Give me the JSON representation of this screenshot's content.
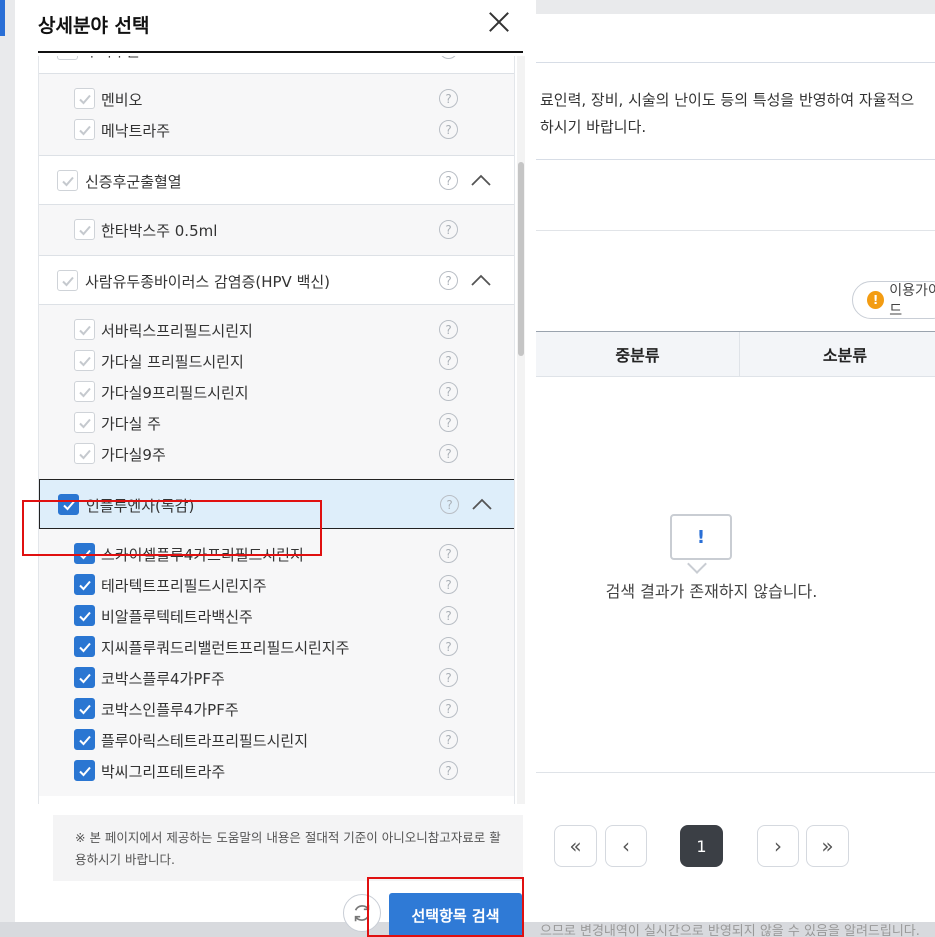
{
  "modal": {
    "title": "상세분야 선택",
    "close_icon": "close-icon",
    "help_note": "※ 본 페이지에서 제공하는 도움말의 내용은 절대적 기준이 아니오니참고자료로 활용하시기 바랍니다.",
    "reset_icon": "refresh-icon",
    "search_button": "선택항목 검색"
  },
  "groups": [
    {
      "label": "수막구균",
      "checked": false,
      "items": [
        {
          "label": "멘비오",
          "checked": false
        },
        {
          "label": "메낙트라주",
          "checked": false
        }
      ]
    },
    {
      "label": "신증후군출혈열",
      "checked": false,
      "items": [
        {
          "label": "한타박스주 0.5ml",
          "checked": false
        }
      ]
    },
    {
      "label": "사람유두종바이러스 감염증(HPV 백신)",
      "checked": false,
      "items": [
        {
          "label": "서바릭스프리필드시린지",
          "checked": false
        },
        {
          "label": "가다실 프리필드시린지",
          "checked": false
        },
        {
          "label": "가다실9프리필드시린지",
          "checked": false
        },
        {
          "label": "가다실 주",
          "checked": false
        },
        {
          "label": "가다실9주",
          "checked": false
        }
      ]
    },
    {
      "label": "인플루엔자(독감)",
      "checked": true,
      "items": [
        {
          "label": "스카이셀플루4가프리필드시린지",
          "checked": true
        },
        {
          "label": "테라텍트프리필드시린지주",
          "checked": true
        },
        {
          "label": "비알플루텍테트라백신주",
          "checked": true
        },
        {
          "label": "지씨플루쿼드리밸런트프리필드시린지주",
          "checked": true
        },
        {
          "label": "코박스플루4가PF주",
          "checked": true
        },
        {
          "label": "코박스인플루4가PF주",
          "checked": true
        },
        {
          "label": "플루아릭스테트라프리필드시린지",
          "checked": true
        },
        {
          "label": "박씨그리프테트라주",
          "checked": true
        }
      ]
    }
  ],
  "background": {
    "notice_lines": [
      "료인력, 장비, 시술의 난이도 등의 특성을 반영하여 자율적으",
      "하시기 바랍니다."
    ],
    "usage_button": "이용가이드",
    "table_headers": [
      "중분류",
      "소분류"
    ],
    "empty_message": "검색 결과가 존재하지 않습니다.",
    "empty_icon_glyph": "!",
    "pagination": {
      "first": "«",
      "prev": "‹",
      "current": "1",
      "next": "›",
      "last": "»"
    },
    "bottom_text": "으므로 변경내역이 실시간으로 반영되지 않을 수 있음을 알려드립니다."
  },
  "colors": {
    "accent": "#2f7ad6",
    "selected_row": "#deeefa",
    "highlight": "#e01010"
  }
}
